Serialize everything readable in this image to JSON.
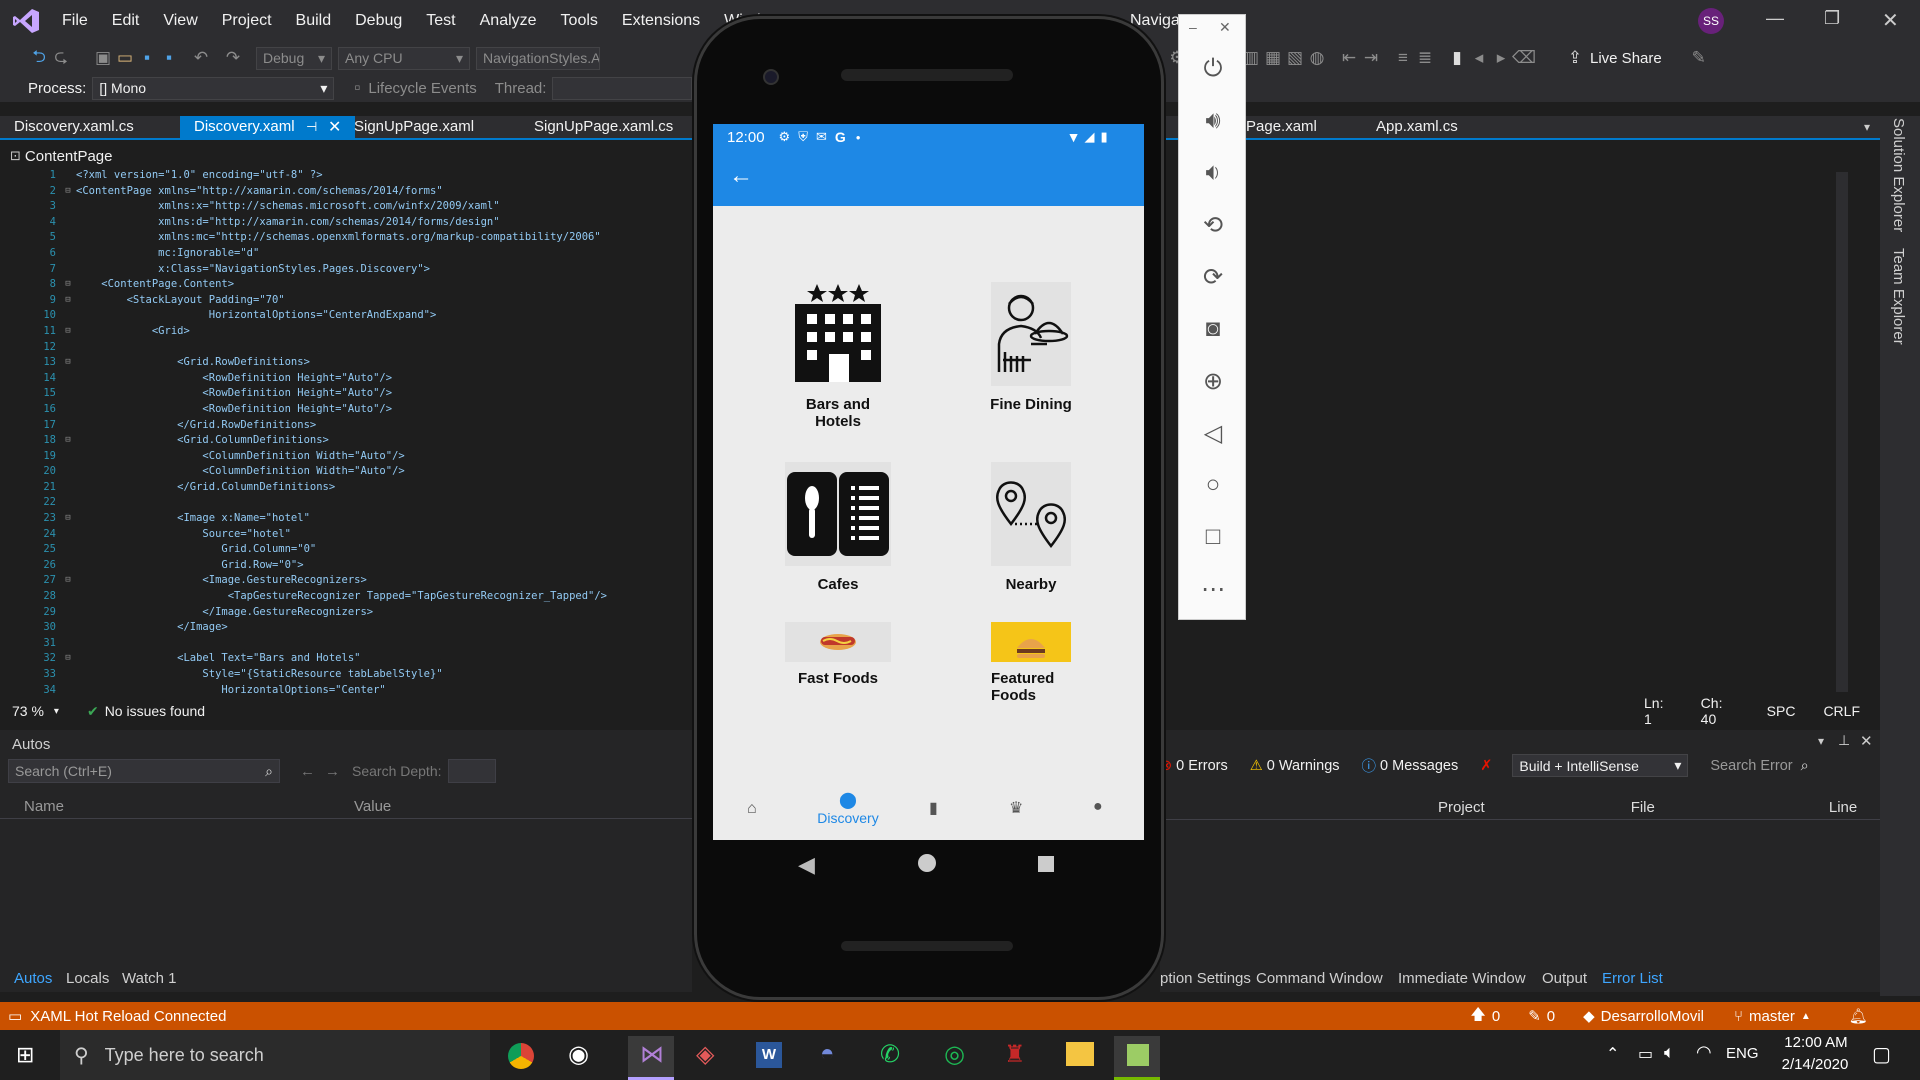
{
  "menu": [
    "File",
    "Edit",
    "View",
    "Project",
    "Build",
    "Debug",
    "Test",
    "Analyze",
    "Tools",
    "Extensions",
    "Wind"
  ],
  "window_title": "Naviga",
  "user_initials": "SS",
  "toolbar": {
    "config": "Debug",
    "platform": "Any CPU",
    "project": "NavigationStyles.A",
    "live_share": "Live Share"
  },
  "process_bar": {
    "process_label": "Process:",
    "process_value": "[] Mono",
    "lifecycle": "Lifecycle Events",
    "thread_label": "Thread:"
  },
  "tabs": [
    "Discovery.xaml.cs",
    "Discovery.xaml",
    "SignUpPage.xaml",
    "SignUpPage.xaml.cs",
    "Page.xaml",
    "App.xaml.cs"
  ],
  "nav_scope": "ContentPage",
  "code_lines": [
    {
      "n": "1",
      "fold": "",
      "text": "<?xml version=\"1.0\" encoding=\"utf-8\" ?>"
    },
    {
      "n": "2",
      "fold": "⊟",
      "text": "<ContentPage xmlns=\"http://xamarin.com/schemas/2014/forms\""
    },
    {
      "n": "3",
      "fold": "",
      "text": "             xmlns:x=\"http://schemas.microsoft.com/winfx/2009/xaml\""
    },
    {
      "n": "4",
      "fold": "",
      "text": "             xmlns:d=\"http://xamarin.com/schemas/2014/forms/design\""
    },
    {
      "n": "5",
      "fold": "",
      "text": "             xmlns:mc=\"http://schemas.openxmlformats.org/markup-compatibility/2006\""
    },
    {
      "n": "6",
      "fold": "",
      "text": "             mc:Ignorable=\"d\""
    },
    {
      "n": "7",
      "fold": "",
      "text": "             x:Class=\"NavigationStyles.Pages.Discovery\">"
    },
    {
      "n": "8",
      "fold": "⊟",
      "text": "    <ContentPage.Content>"
    },
    {
      "n": "9",
      "fold": "⊟",
      "text": "        <StackLayout Padding=\"70\""
    },
    {
      "n": "10",
      "fold": "",
      "text": "                     HorizontalOptions=\"CenterAndExpand\">"
    },
    {
      "n": "11",
      "fold": "⊟",
      "text": "            <Grid>"
    },
    {
      "n": "12",
      "fold": "",
      "text": ""
    },
    {
      "n": "13",
      "fold": "⊟",
      "text": "                <Grid.RowDefinitions>"
    },
    {
      "n": "14",
      "fold": "",
      "text": "                    <RowDefinition Height=\"Auto\"/>"
    },
    {
      "n": "15",
      "fold": "",
      "text": "                    <RowDefinition Height=\"Auto\"/>"
    },
    {
      "n": "16",
      "fold": "",
      "text": "                    <RowDefinition Height=\"Auto\"/>"
    },
    {
      "n": "17",
      "fold": "",
      "text": "                </Grid.RowDefinitions>"
    },
    {
      "n": "18",
      "fold": "⊟",
      "text": "                <Grid.ColumnDefinitions>"
    },
    {
      "n": "19",
      "fold": "",
      "text": "                    <ColumnDefinition Width=\"Auto\"/>"
    },
    {
      "n": "20",
      "fold": "",
      "text": "                    <ColumnDefinition Width=\"Auto\"/>"
    },
    {
      "n": "21",
      "fold": "",
      "text": "                </Grid.ColumnDefinitions>"
    },
    {
      "n": "22",
      "fold": "",
      "text": ""
    },
    {
      "n": "23",
      "fold": "⊟",
      "text": "                <Image x:Name=\"hotel\""
    },
    {
      "n": "24",
      "fold": "",
      "text": "                    Source=\"hotel\""
    },
    {
      "n": "25",
      "fold": "",
      "text": "                       Grid.Column=\"0\""
    },
    {
      "n": "26",
      "fold": "",
      "text": "                       Grid.Row=\"0\">"
    },
    {
      "n": "27",
      "fold": "⊟",
      "text": "                    <Image.GestureRecognizers>"
    },
    {
      "n": "28",
      "fold": "",
      "text": "                        <TapGestureRecognizer Tapped=\"TapGestureRecognizer_Tapped\"/>"
    },
    {
      "n": "29",
      "fold": "",
      "text": "                    </Image.GestureRecognizers>"
    },
    {
      "n": "30",
      "fold": "",
      "text": "                </Image>"
    },
    {
      "n": "31",
      "fold": "",
      "text": ""
    },
    {
      "n": "32",
      "fold": "⊟",
      "text": "                <Label Text=\"Bars and Hotels\""
    },
    {
      "n": "33",
      "fold": "",
      "text": "                    Style=\"{StaticResource tabLabelStyle}\""
    },
    {
      "n": "34",
      "fold": "",
      "text": "                       HorizontalOptions=\"Center\""
    }
  ],
  "editor_status": {
    "zoom": "73 %",
    "issues": "No issues found",
    "ln": "Ln: 1",
    "ch": "Ch: 40",
    "spc": "SPC",
    "crlf": "CRLF"
  },
  "autos": {
    "title": "Autos",
    "search_placeholder": "Search (Ctrl+E)",
    "search_depth": "Search Depth:",
    "col_name": "Name",
    "col_value": "Value"
  },
  "errors": {
    "errors": "0 Errors",
    "warnings": "0 Warnings",
    "messages": "0 Messages",
    "build": "Build + IntelliSense",
    "search": "Search Error",
    "col_project": "Project",
    "col_file": "File",
    "col_line": "Line"
  },
  "bottom_tabs_left": [
    "Autos",
    "Locals",
    "Watch 1"
  ],
  "bottom_tabs_right": [
    "ption Settings",
    "Command Window",
    "Immediate Window",
    "Output",
    "Error List"
  ],
  "side_tabs": [
    "Solution Explorer",
    "Team Explorer"
  ],
  "vs_status": {
    "hot_reload": "XAML Hot Reload Connected",
    "up": "0",
    "pencil": "0",
    "repo": "DesarrolloMovil",
    "branch": "master"
  },
  "taskbar": {
    "search_placeholder": "Type here to search",
    "lang": "ENG",
    "time": "12:00 AM",
    "date": "2/14/2020"
  },
  "phone": {
    "time": "12:00",
    "tiles": [
      {
        "label": "Bars and Hotels",
        "icon": "hotel-icon"
      },
      {
        "label": "Fine Dining",
        "icon": "waiter-icon"
      },
      {
        "label": "Cafes",
        "icon": "menu-icon"
      },
      {
        "label": "Nearby",
        "icon": "route-pins-icon"
      },
      {
        "label": "Fast Foods",
        "icon": "hotdog-icon"
      },
      {
        "label": "Featured Foods",
        "icon": "burger-icon"
      }
    ],
    "nav_active": "Discovery"
  },
  "colors": {
    "accent": "#007acc",
    "status_orange": "#ca5100",
    "app_blue": "#1e88e5",
    "error_list_blue": "#3ea6ff"
  }
}
